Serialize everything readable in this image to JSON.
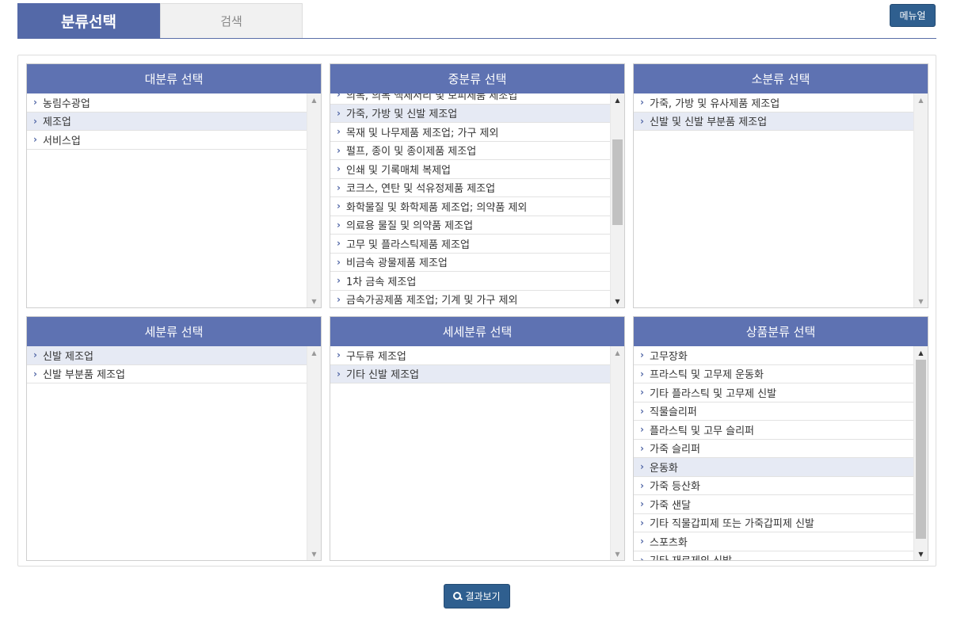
{
  "tabs": {
    "active": "분류선택",
    "inactive": "검색"
  },
  "menu_button": "메뉴얼",
  "result_button": "결과보기",
  "colors": {
    "header": "#5e72b2",
    "tab_active": "#5469a8",
    "button": "#2f5f8f",
    "selected_row": "#e6eaf4"
  },
  "panels": {
    "large": {
      "title": "대분류 선택",
      "items": [
        "농림수광업",
        "제조업",
        "서비스업"
      ],
      "selected": 1
    },
    "medium": {
      "title": "중분류 선택",
      "items": [
        "의복, 의복 액세서리 및 모피제품 제조업",
        "가죽, 가방 및 신발 제조업",
        "목재 및 나무제품 제조업; 가구 제외",
        "펄프, 종이 및 종이제품 제조업",
        "인쇄 및 기록매체 복제업",
        "코크스, 연탄 및 석유정제품 제조업",
        "화학물질 및 화학제품 제조업; 의약품 제외",
        "의료용 물질 및 의약품 제조업",
        "고무 및 플라스틱제품 제조업",
        "비금속 광물제품 제조업",
        "1차 금속 제조업",
        "금속가공제품 제조업; 기계 및 가구 제외"
      ],
      "selected": 1
    },
    "small": {
      "title": "소분류 선택",
      "items": [
        "가죽, 가방 및 유사제품 제조업",
        "신발 및 신발 부분품 제조업"
      ],
      "selected": 1
    },
    "detail": {
      "title": "세분류 선택",
      "items": [
        "신발 제조업",
        "신발 부분품 제조업"
      ],
      "selected": 0
    },
    "subdetail": {
      "title": "세세분류 선택",
      "items": [
        "구두류 제조업",
        "기타 신발 제조업"
      ],
      "selected": 1
    },
    "product": {
      "title": "상품분류 선택",
      "items": [
        "고무장화",
        "프라스틱 및 고무제 운동화",
        "기타 플라스틱 및 고무제 신발",
        "직물슬리퍼",
        "플라스틱 및 고무 슬리퍼",
        "가죽 슬리퍼",
        "운동화",
        "가죽 등산화",
        "가죽 샌달",
        "기타 직물갑피제 또는 가죽갑피제 신발",
        "스포츠화",
        "기타 재료제의 신발"
      ],
      "selected": 6
    }
  }
}
